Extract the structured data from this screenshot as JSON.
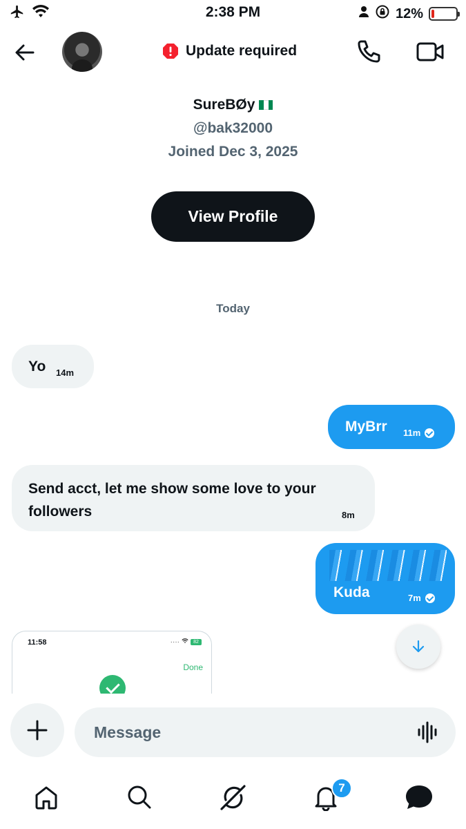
{
  "status_bar": {
    "time": "2:38 PM",
    "battery_text": "12%",
    "battery_level": 0.12,
    "icons": [
      "airplane-icon",
      "wifi-icon",
      "person-icon",
      "rotation-lock-icon",
      "battery-icon"
    ]
  },
  "header": {
    "update_text": "Update required",
    "icons": [
      "back-arrow-icon",
      "alert-icon",
      "phone-icon",
      "video-icon"
    ]
  },
  "profile": {
    "name": "SureBØy",
    "handle": "@bak32000",
    "joined": "Joined Dec 3, 2025",
    "view_profile_label": "View Profile"
  },
  "conversation": {
    "day_label": "Today",
    "messages": [
      {
        "direction": "in",
        "text": "Yo",
        "time": "14m"
      },
      {
        "direction": "out",
        "text": "MyBrr",
        "time": "11m"
      },
      {
        "direction": "in",
        "text": "Send acct, let me show some love to your followers",
        "time": "8m"
      },
      {
        "direction": "out",
        "text": "Kuda",
        "time": "7m"
      }
    ],
    "image_preview": {
      "time": "11:58",
      "battery": "82",
      "done_label": "Done"
    }
  },
  "composer": {
    "placeholder": "Message"
  },
  "bottom_nav": {
    "items": [
      "home-icon",
      "search-icon",
      "grok-icon",
      "notifications-icon",
      "messages-icon"
    ],
    "notification_badge": "7"
  },
  "colors": {
    "accent": "#1d9bf0",
    "bubble_in": "#eff3f4",
    "text_primary": "#0f1419",
    "text_secondary": "#536471",
    "alert": "#f4212e"
  }
}
